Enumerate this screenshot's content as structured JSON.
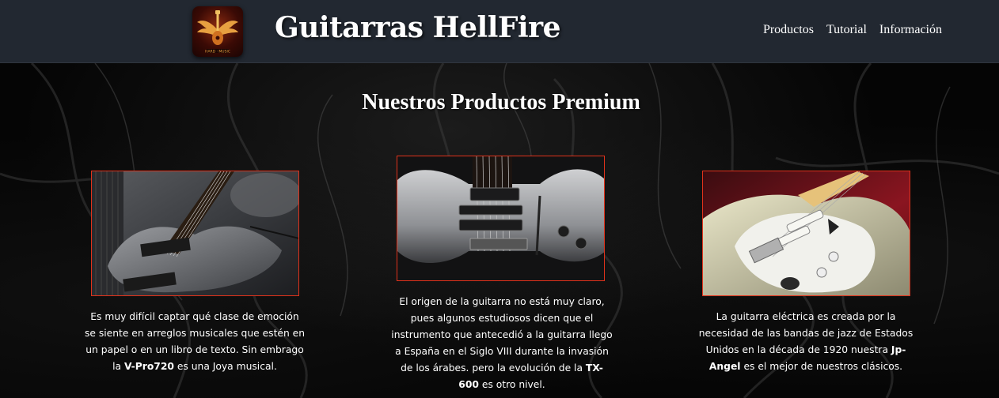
{
  "header": {
    "brand_title": "Guitarras HellFire",
    "nav": [
      {
        "label": "Productos"
      },
      {
        "label": "Tutorial"
      },
      {
        "label": "Información"
      }
    ]
  },
  "main": {
    "title": "Nuestros Productos Premium",
    "products": [
      {
        "text_before": "Es muy difícil captar qué clase de emoción se siente en arreglos musicales que estén en un papel o en un libro de texto. Sin embrago la ",
        "name": "V-Pro720",
        "text_after": " es una Joya musical."
      },
      {
        "text_before": "El origen de la guitarra no está muy claro, pues algunos estudiosos dicen que el instrumento que antecedió a la guitarra llego a España en el Siglo VIII durante la invasión de los árabes. pero la evolución de la ",
        "name": "TX-600",
        "text_after": " es otro nivel."
      },
      {
        "text_before": "La guitarra eléctrica es creada por la necesidad de las bandas de jazz de Estados Unidos en la década de 1920 nuestra ",
        "name": "Jp-Angel",
        "text_after": " es el mejor de nuestros clásicos."
      }
    ]
  },
  "colors": {
    "header_bg": "#222831",
    "card_border": "#e0321b",
    "page_bg": "#050505"
  },
  "icons": {
    "logo": "winged-guitar-logo-icon"
  }
}
